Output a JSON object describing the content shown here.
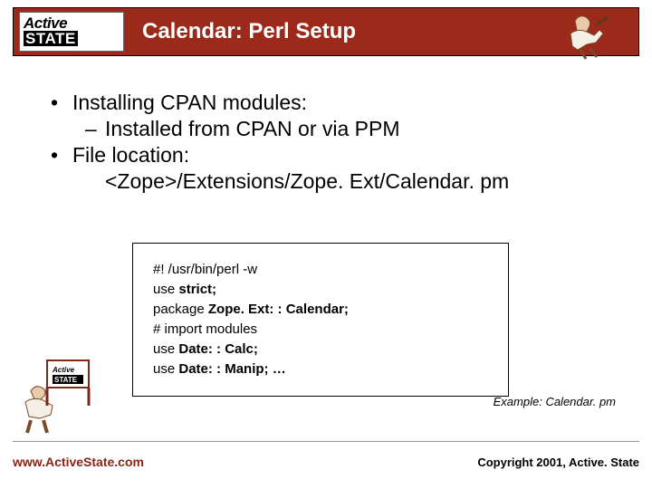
{
  "brand": {
    "top": "Active",
    "bottom": "STATE"
  },
  "title": "Calendar: Perl Setup",
  "bullets": {
    "b1": "Installing CPAN modules:",
    "b1a": "Installed from CPAN or via PPM",
    "b2": "File location:",
    "b2a": "<Zope>/Extensions/Zope. Ext/Calendar. pm"
  },
  "code": {
    "l1": "#! /usr/bin/perl -w",
    "l2a": "use ",
    "l2b": "strict;",
    "l3a": "package ",
    "l3b": "Zope. Ext: : Calendar;",
    "l4": "# import modules",
    "l5a": "use ",
    "l5b": "Date: : Calc;",
    "l6a": "use ",
    "l6b": "Date: : Manip; …"
  },
  "code_caption": "Example: Calendar. pm",
  "footer": {
    "url": "www.ActiveState.com",
    "copyright": "Copyright 2001, Active. State"
  }
}
